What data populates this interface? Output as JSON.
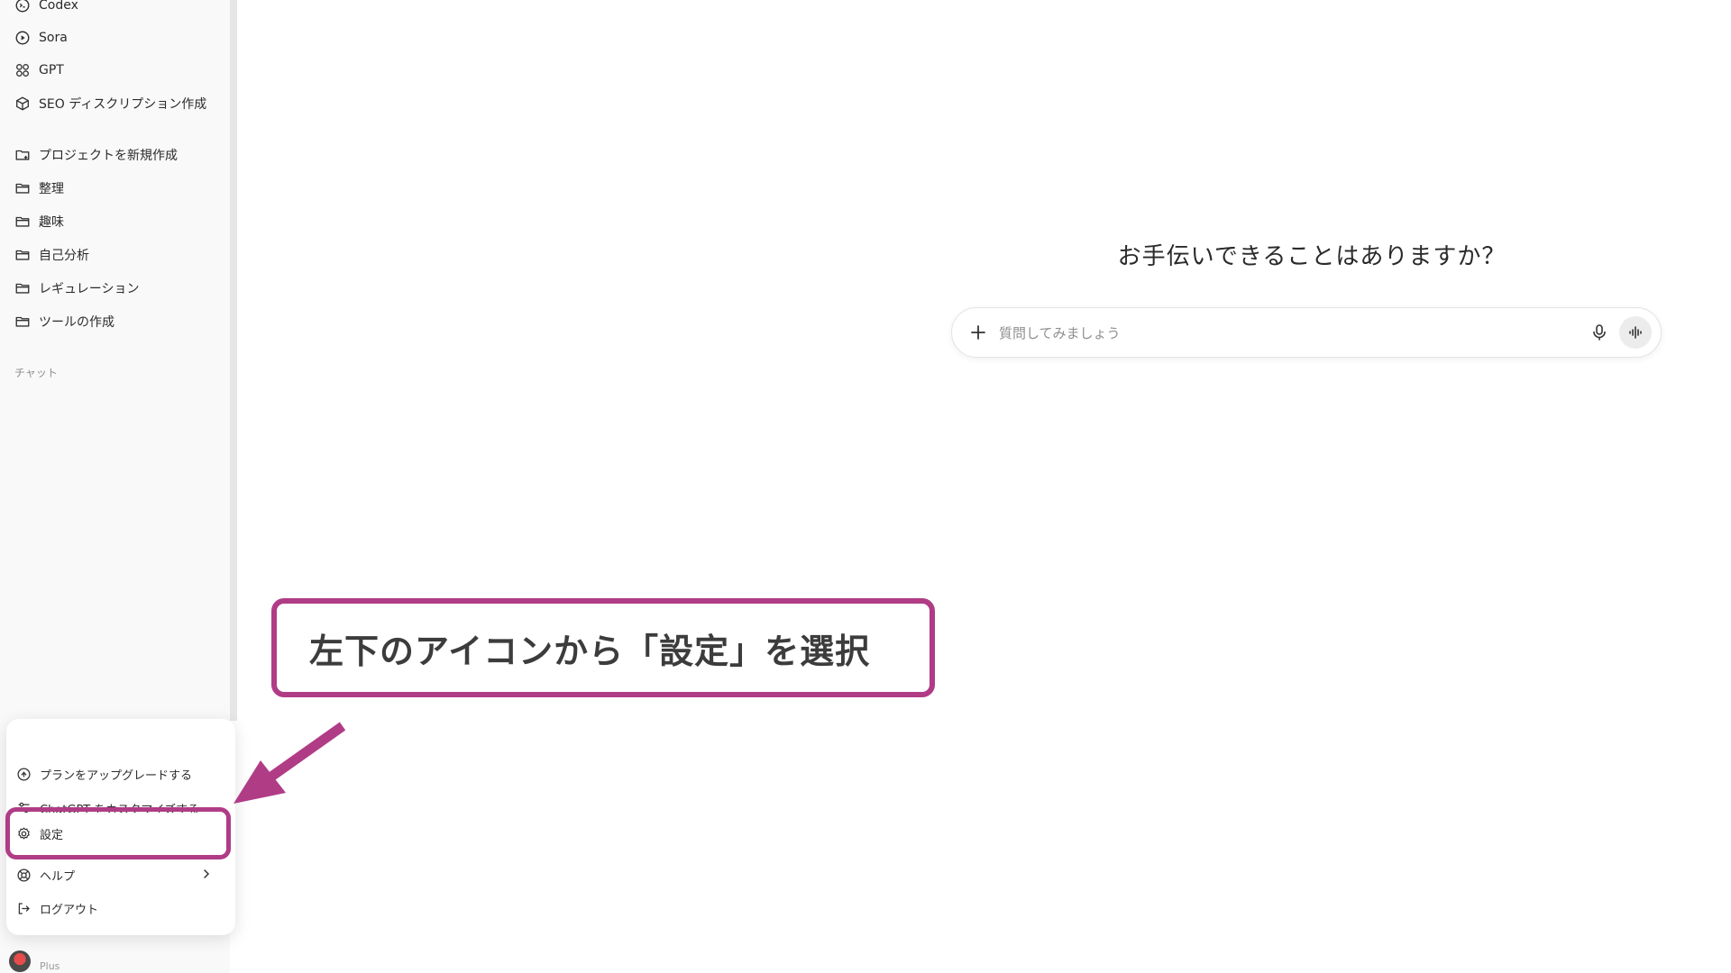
{
  "sidebar": {
    "top_items": [
      {
        "label": "Codex",
        "icon": "codex-icon"
      },
      {
        "label": "Sora",
        "icon": "play-circle-icon"
      },
      {
        "label": "GPT",
        "icon": "grid-icon"
      },
      {
        "label": "SEO ディスクリプション作成",
        "icon": "cube-icon"
      }
    ],
    "projects": [
      {
        "label": "プロジェクトを新規作成",
        "icon": "folder-plus-icon"
      },
      {
        "label": "整理",
        "icon": "folder-icon"
      },
      {
        "label": "趣味",
        "icon": "folder-icon"
      },
      {
        "label": "自己分析",
        "icon": "folder-icon"
      },
      {
        "label": "レギュレーション",
        "icon": "folder-icon"
      },
      {
        "label": "ツールの作成",
        "icon": "folder-icon"
      }
    ],
    "chat_section_label": "チャット"
  },
  "main": {
    "welcome": "お手伝いできることはありますか？",
    "composer": {
      "placeholder": "質問してみましょう"
    }
  },
  "menu": {
    "items": [
      {
        "label": "プランをアップグレードする",
        "icon": "upgrade-icon"
      },
      {
        "label": "ChatGPT をカスタマイズする",
        "icon": "customize-icon"
      },
      {
        "label": "設定",
        "icon": "gear-icon"
      },
      {
        "label": "ヘルプ",
        "icon": "help-icon"
      },
      {
        "label": "ログアウト",
        "icon": "logout-icon"
      }
    ]
  },
  "user": {
    "plan": "Plus"
  },
  "annotation": {
    "callout_text": "左下のアイコンから「設定」を選択",
    "accent_color": "#b03c86"
  }
}
